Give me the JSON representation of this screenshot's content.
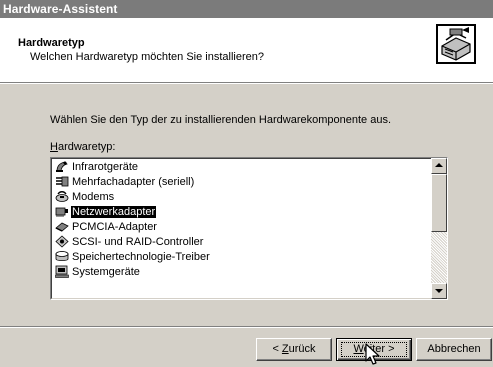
{
  "window": {
    "title": "Hardware-Assistent"
  },
  "header": {
    "title": "Hardwaretyp",
    "subtitle": "Welchen Hardwaretyp möchten Sie installieren?",
    "icon": "hardware-wizard-icon"
  },
  "main": {
    "instruction": "Wählen Sie den Typ der zu installierenden Hardwarekomponente aus.",
    "list_label_accel": "H",
    "list_label_rest": "ardwaretyp:",
    "items": [
      {
        "label": "Infrarotgeräte",
        "icon": "infrared-icon"
      },
      {
        "label": "Mehrfachadapter (seriell)",
        "icon": "multiport-serial-icon"
      },
      {
        "label": "Modems",
        "icon": "modem-icon"
      },
      {
        "label": "Netzwerkadapter",
        "icon": "network-adapter-icon",
        "selected": true
      },
      {
        "label": "PCMCIA-Adapter",
        "icon": "pcmcia-icon"
      },
      {
        "label": "SCSI- und RAID-Controller",
        "icon": "scsi-icon"
      },
      {
        "label": "Speichertechnologie-Treiber",
        "icon": "storage-icon"
      },
      {
        "label": "Systemgeräte",
        "icon": "system-devices-icon"
      }
    ]
  },
  "footer": {
    "back_prefix": "< ",
    "back_accel": "Z",
    "back_rest": "urück",
    "next_accel": "W",
    "next_rest": "eiter >",
    "cancel": "Abbrechen"
  },
  "colors": {
    "selection_bg": "#000000",
    "dialog_bg": "#d4d0c8",
    "titlebar": "#7b7b7b"
  }
}
